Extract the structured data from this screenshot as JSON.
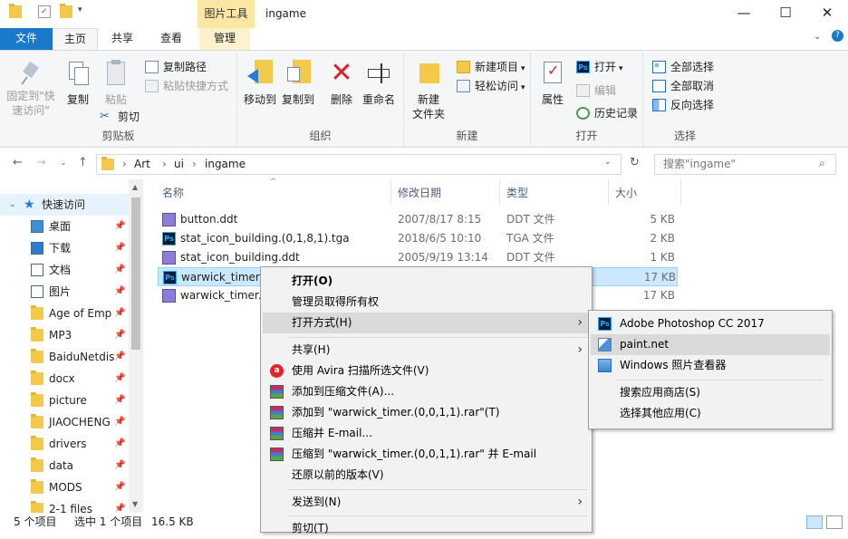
{
  "window": {
    "title": "ingame",
    "context_tab": "图片工具",
    "controls": [
      "—",
      "☐",
      "✕"
    ]
  },
  "ribbon_tabs": [
    "文件",
    "主页",
    "共享",
    "查看",
    "管理"
  ],
  "ribbon": {
    "clipboard": {
      "label": "剪贴板",
      "pin": "固定到\"快速访问\"",
      "copy": "复制",
      "paste": "粘贴",
      "copy_path": "复制路径",
      "paste_shortcut": "粘贴快捷方式",
      "cut": "剪切"
    },
    "organize": {
      "label": "组织",
      "move_to": "移动到",
      "copy_to": "复制到",
      "delete": "删除",
      "rename": "重命名"
    },
    "new": {
      "label": "新建",
      "new_folder": "新建\n文件夹",
      "new_item": "新建项目",
      "easy_access": "轻松访问"
    },
    "open": {
      "label": "打开",
      "properties": "属性",
      "open": "打开",
      "edit": "编辑",
      "history": "历史记录"
    },
    "select": {
      "label": "选择",
      "select_all": "全部选择",
      "select_none": "全部取消",
      "invert": "反向选择"
    }
  },
  "address": {
    "path": [
      "Art",
      "ui",
      "ingame"
    ],
    "search_placeholder": "搜索\"ingame\""
  },
  "nav": {
    "quick_access": "快速访问",
    "items": [
      {
        "label": "桌面",
        "icon": "desktop-icon"
      },
      {
        "label": "下载",
        "icon": "download-icon"
      },
      {
        "label": "文档",
        "icon": "document-icon"
      },
      {
        "label": "图片",
        "icon": "picture-icon"
      },
      {
        "label": "Age of Emp",
        "icon": "folder-icon"
      },
      {
        "label": "MP3",
        "icon": "folder-icon"
      },
      {
        "label": "BaiduNetdis",
        "icon": "folder-icon"
      },
      {
        "label": "docx",
        "icon": "folder-icon"
      },
      {
        "label": "picture",
        "icon": "folder-icon"
      },
      {
        "label": "JIAOCHENG",
        "icon": "folder-icon"
      },
      {
        "label": "drivers",
        "icon": "folder-icon"
      },
      {
        "label": "data",
        "icon": "folder-icon"
      },
      {
        "label": "MODS",
        "icon": "folder-icon"
      },
      {
        "label": "2-1 files",
        "icon": "folder-icon"
      }
    ]
  },
  "columns": [
    "名称",
    "修改日期",
    "类型",
    "大小"
  ],
  "files": [
    {
      "name": "button.ddt",
      "date": "2007/8/17 8:15",
      "type": "DDT 文件",
      "size": "5 KB",
      "icon": "ddt"
    },
    {
      "name": "stat_icon_building.(0,1,8,1).tga",
      "date": "2018/6/5 10:10",
      "type": "TGA 文件",
      "size": "2 KB",
      "icon": "ps"
    },
    {
      "name": "stat_icon_building.ddt",
      "date": "2005/9/19 13:14",
      "type": "DDT 文件",
      "size": "1 KB",
      "icon": "ddt"
    },
    {
      "name": "warwick_timer.(",
      "date": "",
      "type": "",
      "size": "17 KB",
      "icon": "ps"
    },
    {
      "name": "warwick_timer.c",
      "date": "",
      "type": "",
      "size": "17 KB",
      "icon": "ddt"
    }
  ],
  "context_menu": [
    "打开(O)",
    "管理员取得所有权",
    "打开方式(H)",
    "共享(H)",
    "使用 Avira 扫描所选文件(V)",
    "添加到压缩文件(A)...",
    "添加到 \"warwick_timer.(0,0,1,1).rar\"(T)",
    "压缩并 E-mail...",
    "压缩到 \"warwick_timer.(0,0,1,1).rar\" 并 E-mail",
    "还原以前的版本(V)",
    "发送到(N)",
    "剪切(T)"
  ],
  "open_with_menu": [
    "Adobe Photoshop CC 2017",
    "paint.net",
    "Windows 照片查看器",
    "搜索应用商店(S)",
    "选择其他应用(C)"
  ],
  "status": {
    "count": "5 个项目",
    "selected": "选中 1 个项目",
    "size": "16.5 KB"
  }
}
